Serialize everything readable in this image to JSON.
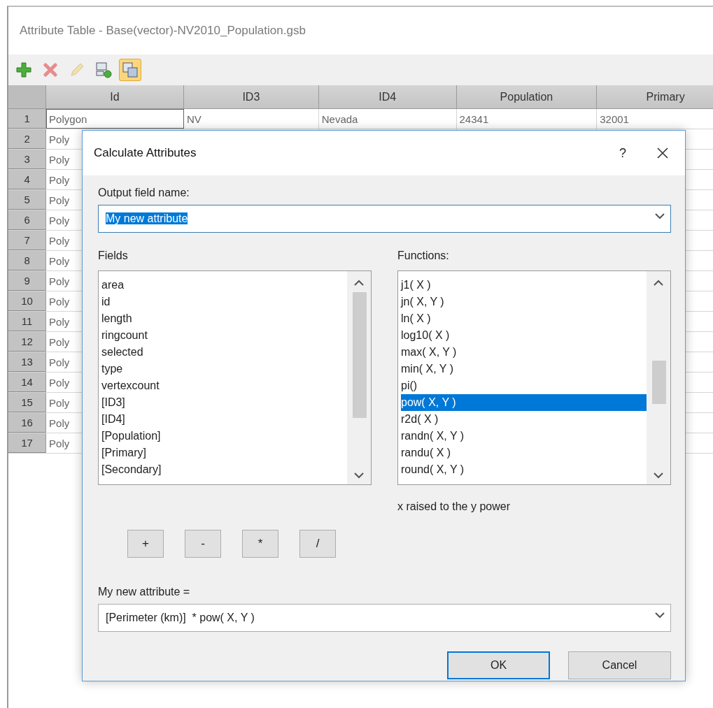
{
  "window": {
    "title": "Attribute Table - Base(vector)-NV2010_Population.gsb"
  },
  "toolbar": [
    {
      "kind": "add",
      "disabled": false,
      "active": false
    },
    {
      "kind": "delete",
      "disabled": true,
      "active": false
    },
    {
      "kind": "edit",
      "disabled": true,
      "active": false
    },
    {
      "kind": "add-field",
      "disabled": false,
      "active": false
    },
    {
      "kind": "calculate",
      "disabled": false,
      "active": true
    }
  ],
  "table": {
    "columns": [
      "Id",
      "ID3",
      "ID4",
      "Population",
      "Primary"
    ],
    "rows": [
      {
        "number": "1",
        "cells": [
          "Polygon",
          "NV",
          "Nevada",
          "24341",
          "32001"
        ]
      },
      {
        "number": "2",
        "cells": [
          "Poly"
        ]
      },
      {
        "number": "3",
        "cells": [
          "Poly"
        ]
      },
      {
        "number": "4",
        "cells": [
          "Poly"
        ]
      },
      {
        "number": "5",
        "cells": [
          "Poly"
        ]
      },
      {
        "number": "6",
        "cells": [
          "Poly"
        ]
      },
      {
        "number": "7",
        "cells": [
          "Poly"
        ]
      },
      {
        "number": "8",
        "cells": [
          "Poly"
        ]
      },
      {
        "number": "9",
        "cells": [
          "Poly"
        ]
      },
      {
        "number": "10",
        "cells": [
          "Poly"
        ]
      },
      {
        "number": "11",
        "cells": [
          "Poly"
        ]
      },
      {
        "number": "12",
        "cells": [
          "Poly"
        ]
      },
      {
        "number": "13",
        "cells": [
          "Poly"
        ]
      },
      {
        "number": "14",
        "cells": [
          "Poly"
        ]
      },
      {
        "number": "15",
        "cells": [
          "Poly"
        ]
      },
      {
        "number": "16",
        "cells": [
          "Poly"
        ]
      },
      {
        "number": "17",
        "cells": [
          "Poly"
        ]
      }
    ]
  },
  "dialog": {
    "title": "Calculate Attributes",
    "help": "?",
    "output_label": "Output field name:",
    "output_value": "My new attribute",
    "output_value_selected": true,
    "fields_label": "Fields",
    "fields": [
      {
        "label": "area",
        "selected": false
      },
      {
        "label": "id",
        "selected": false
      },
      {
        "label": "length",
        "selected": false
      },
      {
        "label": "ringcount",
        "selected": false
      },
      {
        "label": "selected",
        "selected": false
      },
      {
        "label": "type",
        "selected": false
      },
      {
        "label": "vertexcount",
        "selected": false
      },
      {
        "label": "[ID3]",
        "selected": false
      },
      {
        "label": "[ID4]",
        "selected": false
      },
      {
        "label": "[Population]",
        "selected": false
      },
      {
        "label": "[Primary]",
        "selected": false
      },
      {
        "label": "[Secondary]",
        "selected": false
      }
    ],
    "functions_label": "Functions:",
    "functions": [
      {
        "label": "j1( X )",
        "selected": false
      },
      {
        "label": "jn( X, Y )",
        "selected": false
      },
      {
        "label": "ln( X )",
        "selected": false
      },
      {
        "label": "log10( X )",
        "selected": false
      },
      {
        "label": "max( X, Y )",
        "selected": false
      },
      {
        "label": "min( X, Y )",
        "selected": false
      },
      {
        "label": "pi()",
        "selected": false
      },
      {
        "label": "pow( X, Y )",
        "selected": true
      },
      {
        "label": "r2d( X )",
        "selected": false
      },
      {
        "label": "randn( X, Y )",
        "selected": false
      },
      {
        "label": "randu( X )",
        "selected": false
      },
      {
        "label": "round( X, Y )",
        "selected": false
      }
    ],
    "description": "x raised to the y power",
    "operators": [
      "+",
      "-",
      "*",
      "/"
    ],
    "expression_label": "My new attribute =",
    "expression_value": "[Perimeter (km)]  * pow( X, Y )",
    "buttons": [
      {
        "label": "OK",
        "default": true
      },
      {
        "label": "Cancel",
        "default": false
      }
    ]
  }
}
